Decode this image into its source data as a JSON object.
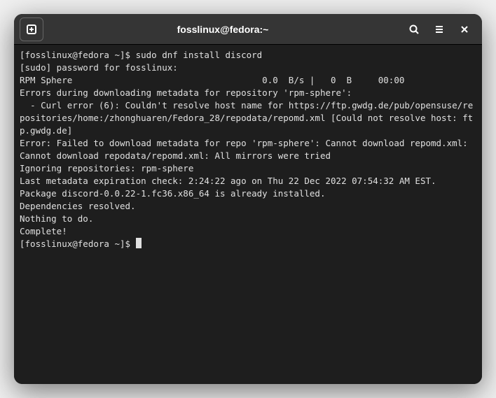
{
  "titlebar": {
    "title": "fosslinux@fedora:~"
  },
  "terminal": {
    "prompt1": "[fosslinux@fedora ~]$ ",
    "command1": "sudo dnf install discord",
    "lines": [
      "[sudo] password for fosslinux:",
      "RPM Sphere                                    0.0  B/s |   0  B     00:00",
      "Errors during downloading metadata for repository 'rpm-sphere':",
      "  - Curl error (6): Couldn't resolve host name for https://ftp.gwdg.de/pub/opensuse/repositories/home:/zhonghuaren/Fedora_28/repodata/repomd.xml [Could not resolve host: ftp.gwdg.de]",
      "Error: Failed to download metadata for repo 'rpm-sphere': Cannot download repomd.xml: Cannot download repodata/repomd.xml: All mirrors were tried",
      "Ignoring repositories: rpm-sphere",
      "Last metadata expiration check: 2:24:22 ago on Thu 22 Dec 2022 07:54:32 AM EST.",
      "Package discord-0.0.22-1.fc36.x86_64 is already installed.",
      "Dependencies resolved.",
      "Nothing to do.",
      "Complete!"
    ],
    "prompt2": "[fosslinux@fedora ~]$ "
  }
}
